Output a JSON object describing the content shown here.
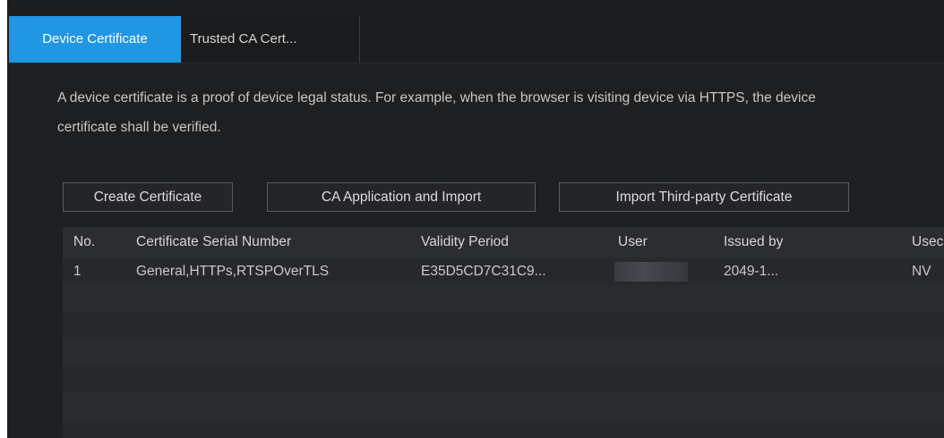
{
  "tabs": [
    {
      "label": "Device Certificate",
      "active": true
    },
    {
      "label": "Trusted CA Cert...",
      "active": false
    }
  ],
  "description": "A device certificate is a proof of device legal status. For example, when the browser is visiting device via HTTPS, the device certificate shall be verified.",
  "buttons": {
    "create": "Create Certificate",
    "ca_application": "CA Application and Import",
    "import_third_party": "Import Third-party Certificate"
  },
  "table": {
    "headers": {
      "no": "No.",
      "serial": "Certificate Serial Number",
      "validity": "Validity Period",
      "user": "User",
      "issued": "Issued by",
      "used": "Usec"
    },
    "rows": [
      {
        "no": "1",
        "serial": "General,HTTPs,RTSPOverTLS",
        "validity": "E35D5CD7C31C9...",
        "user": "",
        "issued": "2049-1...",
        "used": "NV"
      }
    ]
  },
  "colors": {
    "accent": "#2196e3",
    "background": "#1e1f21"
  }
}
